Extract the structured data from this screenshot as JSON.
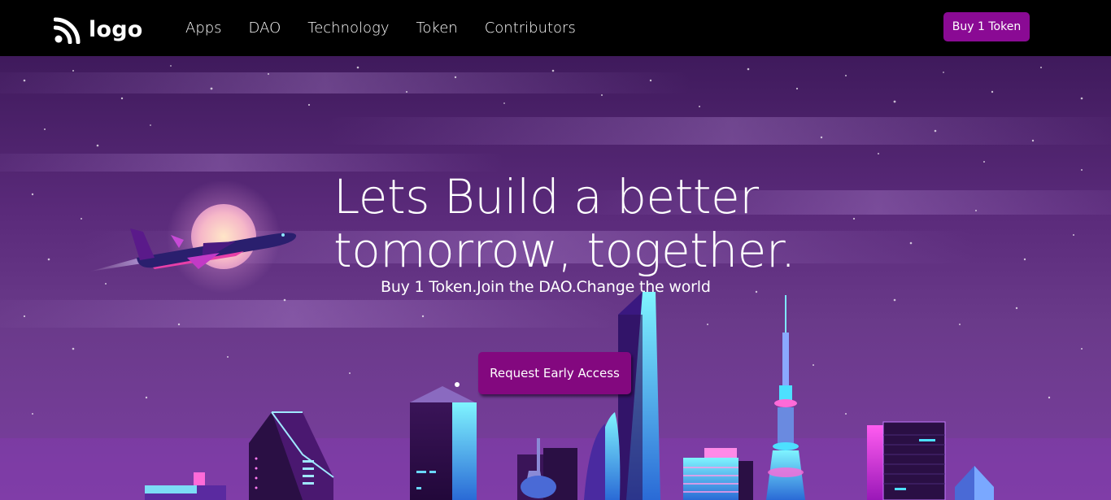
{
  "brand": {
    "name": "logo",
    "icon": "rss-feed-icon"
  },
  "nav": {
    "links": [
      "Apps",
      "DAO",
      "Technology",
      "Token",
      "Contributors"
    ],
    "cta_label": "Buy 1 Token"
  },
  "hero": {
    "title_line1": "Lets Build a better",
    "title_line2": "tomorrow, together.",
    "subtitle": "Buy 1 Token.Join the DAO.Change the world",
    "cta_label": "Request Early Access"
  },
  "colors": {
    "nav_bg": "#000000",
    "accent": "#8a0a94",
    "hero_top": "#3f1a5c",
    "hero_bottom": "#7b3fa0",
    "neon_cyan": "#4de0ff",
    "neon_pink": "#e040fb"
  }
}
